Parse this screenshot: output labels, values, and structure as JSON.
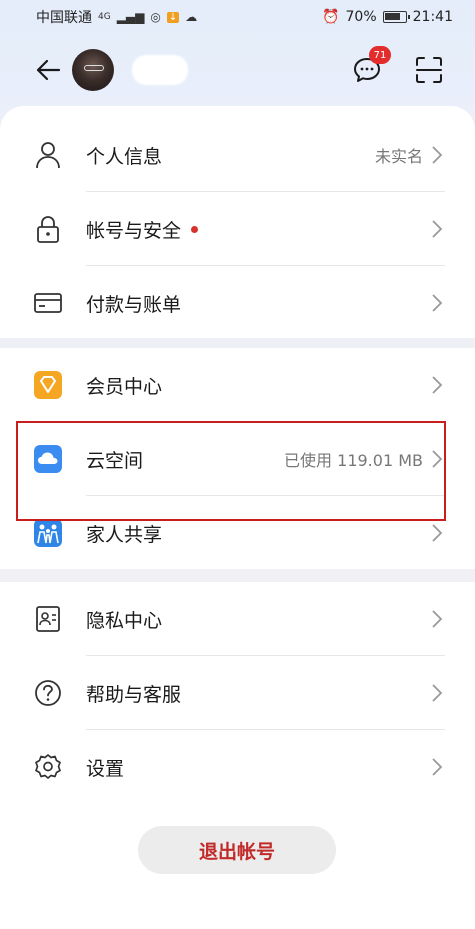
{
  "status_bar": {
    "carrier": "中国联通",
    "signal": "4G",
    "battery": "70%",
    "time": "21:41"
  },
  "header": {
    "message_badge": "71"
  },
  "sections": [
    {
      "items": [
        {
          "icon": "person-icon",
          "label": "个人信息",
          "value": "未实名"
        },
        {
          "icon": "lock-icon",
          "label": "帐号与安全",
          "value": ""
        },
        {
          "icon": "card-icon",
          "label": "付款与账单",
          "value": ""
        }
      ]
    },
    {
      "items": [
        {
          "icon": "diamond-icon",
          "label": "会员中心",
          "value": ""
        },
        {
          "icon": "cloud-icon",
          "label": "云空间",
          "value": "已使用 119.01 MB"
        },
        {
          "icon": "family-icon",
          "label": "家人共享",
          "value": ""
        }
      ]
    },
    {
      "items": [
        {
          "icon": "privacy-icon",
          "label": "隐私中心",
          "value": ""
        },
        {
          "icon": "help-icon",
          "label": "帮助与客服",
          "value": ""
        },
        {
          "icon": "settings-icon",
          "label": "设置",
          "value": ""
        }
      ]
    }
  ],
  "logout_label": "退出帐号",
  "colors": {
    "accent_red": "#c22a2a",
    "highlight_border": "#c81e1e",
    "badge": "#e32d2d",
    "diamond_icon": "#f5a623",
    "cloud_icon": "#3b8cf0",
    "family_icon": "#2f86e6"
  }
}
